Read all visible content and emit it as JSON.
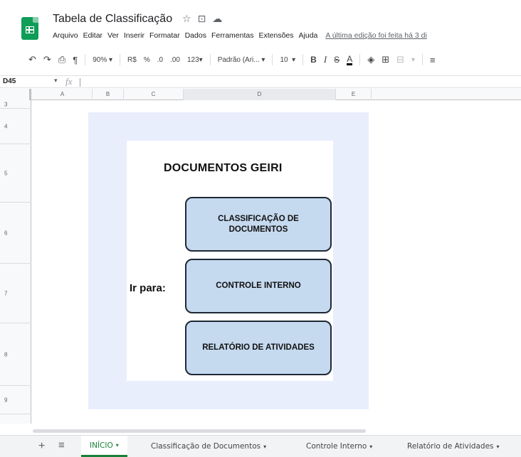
{
  "app": {
    "doc_title": "Tabela de Classificação",
    "title_icons": [
      "star-icon",
      "move-to-folder-icon",
      "cloud-status-icon"
    ]
  },
  "menu": {
    "items": [
      "Arquivo",
      "Editar",
      "Ver",
      "Inserir",
      "Formatar",
      "Dados",
      "Ferramentas",
      "Extensões",
      "Ajuda"
    ],
    "last_edit": "A última edição foi feita há 3 di"
  },
  "toolbar": {
    "zoom": "90%",
    "currency": "R$",
    "percent": "%",
    "decimal_decrease": ".0",
    "decimal_increase": ".00",
    "number_format": "123",
    "font": "Padrão (Ari...",
    "font_size": "10",
    "bold": "B",
    "italic": "I",
    "strike": "S",
    "text_color": "A"
  },
  "formula_bar": {
    "cell_ref": "D45",
    "fx": "fx"
  },
  "grid": {
    "columns": [
      "A",
      "B",
      "C",
      "D",
      "E"
    ],
    "rows": [
      "3",
      "4",
      "5",
      "6",
      "7",
      "8",
      "9"
    ]
  },
  "drawing": {
    "title": "DOCUMENTOS GEIRI",
    "ir_para": "Ir para:",
    "buttons": [
      "CLASSIFICAÇÃO DE DOCUMENTOS",
      "CONTROLE INTERNO",
      "RELATÓRIO DE ATIVIDADES"
    ]
  },
  "sheets": {
    "tabs": [
      "INÍCIO",
      "Classificação de Documentos",
      "Controle Interno",
      "Relatório de Atividades"
    ],
    "active": 0
  },
  "colors": {
    "accent": "#188038",
    "panel_bg": "#e8eefc",
    "button_fill": "#c5d9ef"
  }
}
